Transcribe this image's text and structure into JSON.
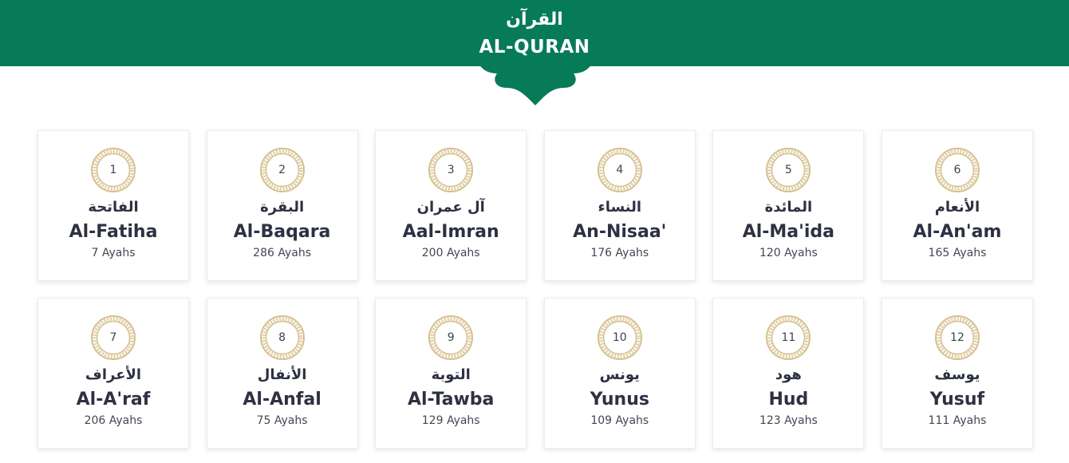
{
  "header": {
    "title_ar": "القرآن",
    "title_en": "AL-QURAN",
    "color": "#077a58"
  },
  "surahs": [
    {
      "number": "1",
      "name_ar": "الفاتحة",
      "name_en": "Al-Fatiha",
      "ayahs": "7 Ayahs"
    },
    {
      "number": "2",
      "name_ar": "البقرة",
      "name_en": "Al-Baqara",
      "ayahs": "286 Ayahs"
    },
    {
      "number": "3",
      "name_ar": "آل عمران",
      "name_en": "Aal-Imran",
      "ayahs": "200 Ayahs"
    },
    {
      "number": "4",
      "name_ar": "النساء",
      "name_en": "An-Nisaa'",
      "ayahs": "176 Ayahs"
    },
    {
      "number": "5",
      "name_ar": "المائدة",
      "name_en": "Al-Ma'ida",
      "ayahs": "120 Ayahs"
    },
    {
      "number": "6",
      "name_ar": "الأنعام",
      "name_en": "Al-An'am",
      "ayahs": "165 Ayahs"
    },
    {
      "number": "7",
      "name_ar": "الأعراف",
      "name_en": "Al-A'raf",
      "ayahs": "206 Ayahs"
    },
    {
      "number": "8",
      "name_ar": "الأنفال",
      "name_en": "Al-Anfal",
      "ayahs": "75 Ayahs"
    },
    {
      "number": "9",
      "name_ar": "التوبة",
      "name_en": "Al-Tawba",
      "ayahs": "129 Ayahs"
    },
    {
      "number": "10",
      "name_ar": "يونس",
      "name_en": "Yunus",
      "ayahs": "109 Ayahs"
    },
    {
      "number": "11",
      "name_ar": "هود",
      "name_en": "Hud",
      "ayahs": "123 Ayahs"
    },
    {
      "number": "12",
      "name_ar": "يوسف",
      "name_en": "Yusuf",
      "ayahs": "111 Ayahs"
    }
  ],
  "ornament_color": "#d6c08f"
}
